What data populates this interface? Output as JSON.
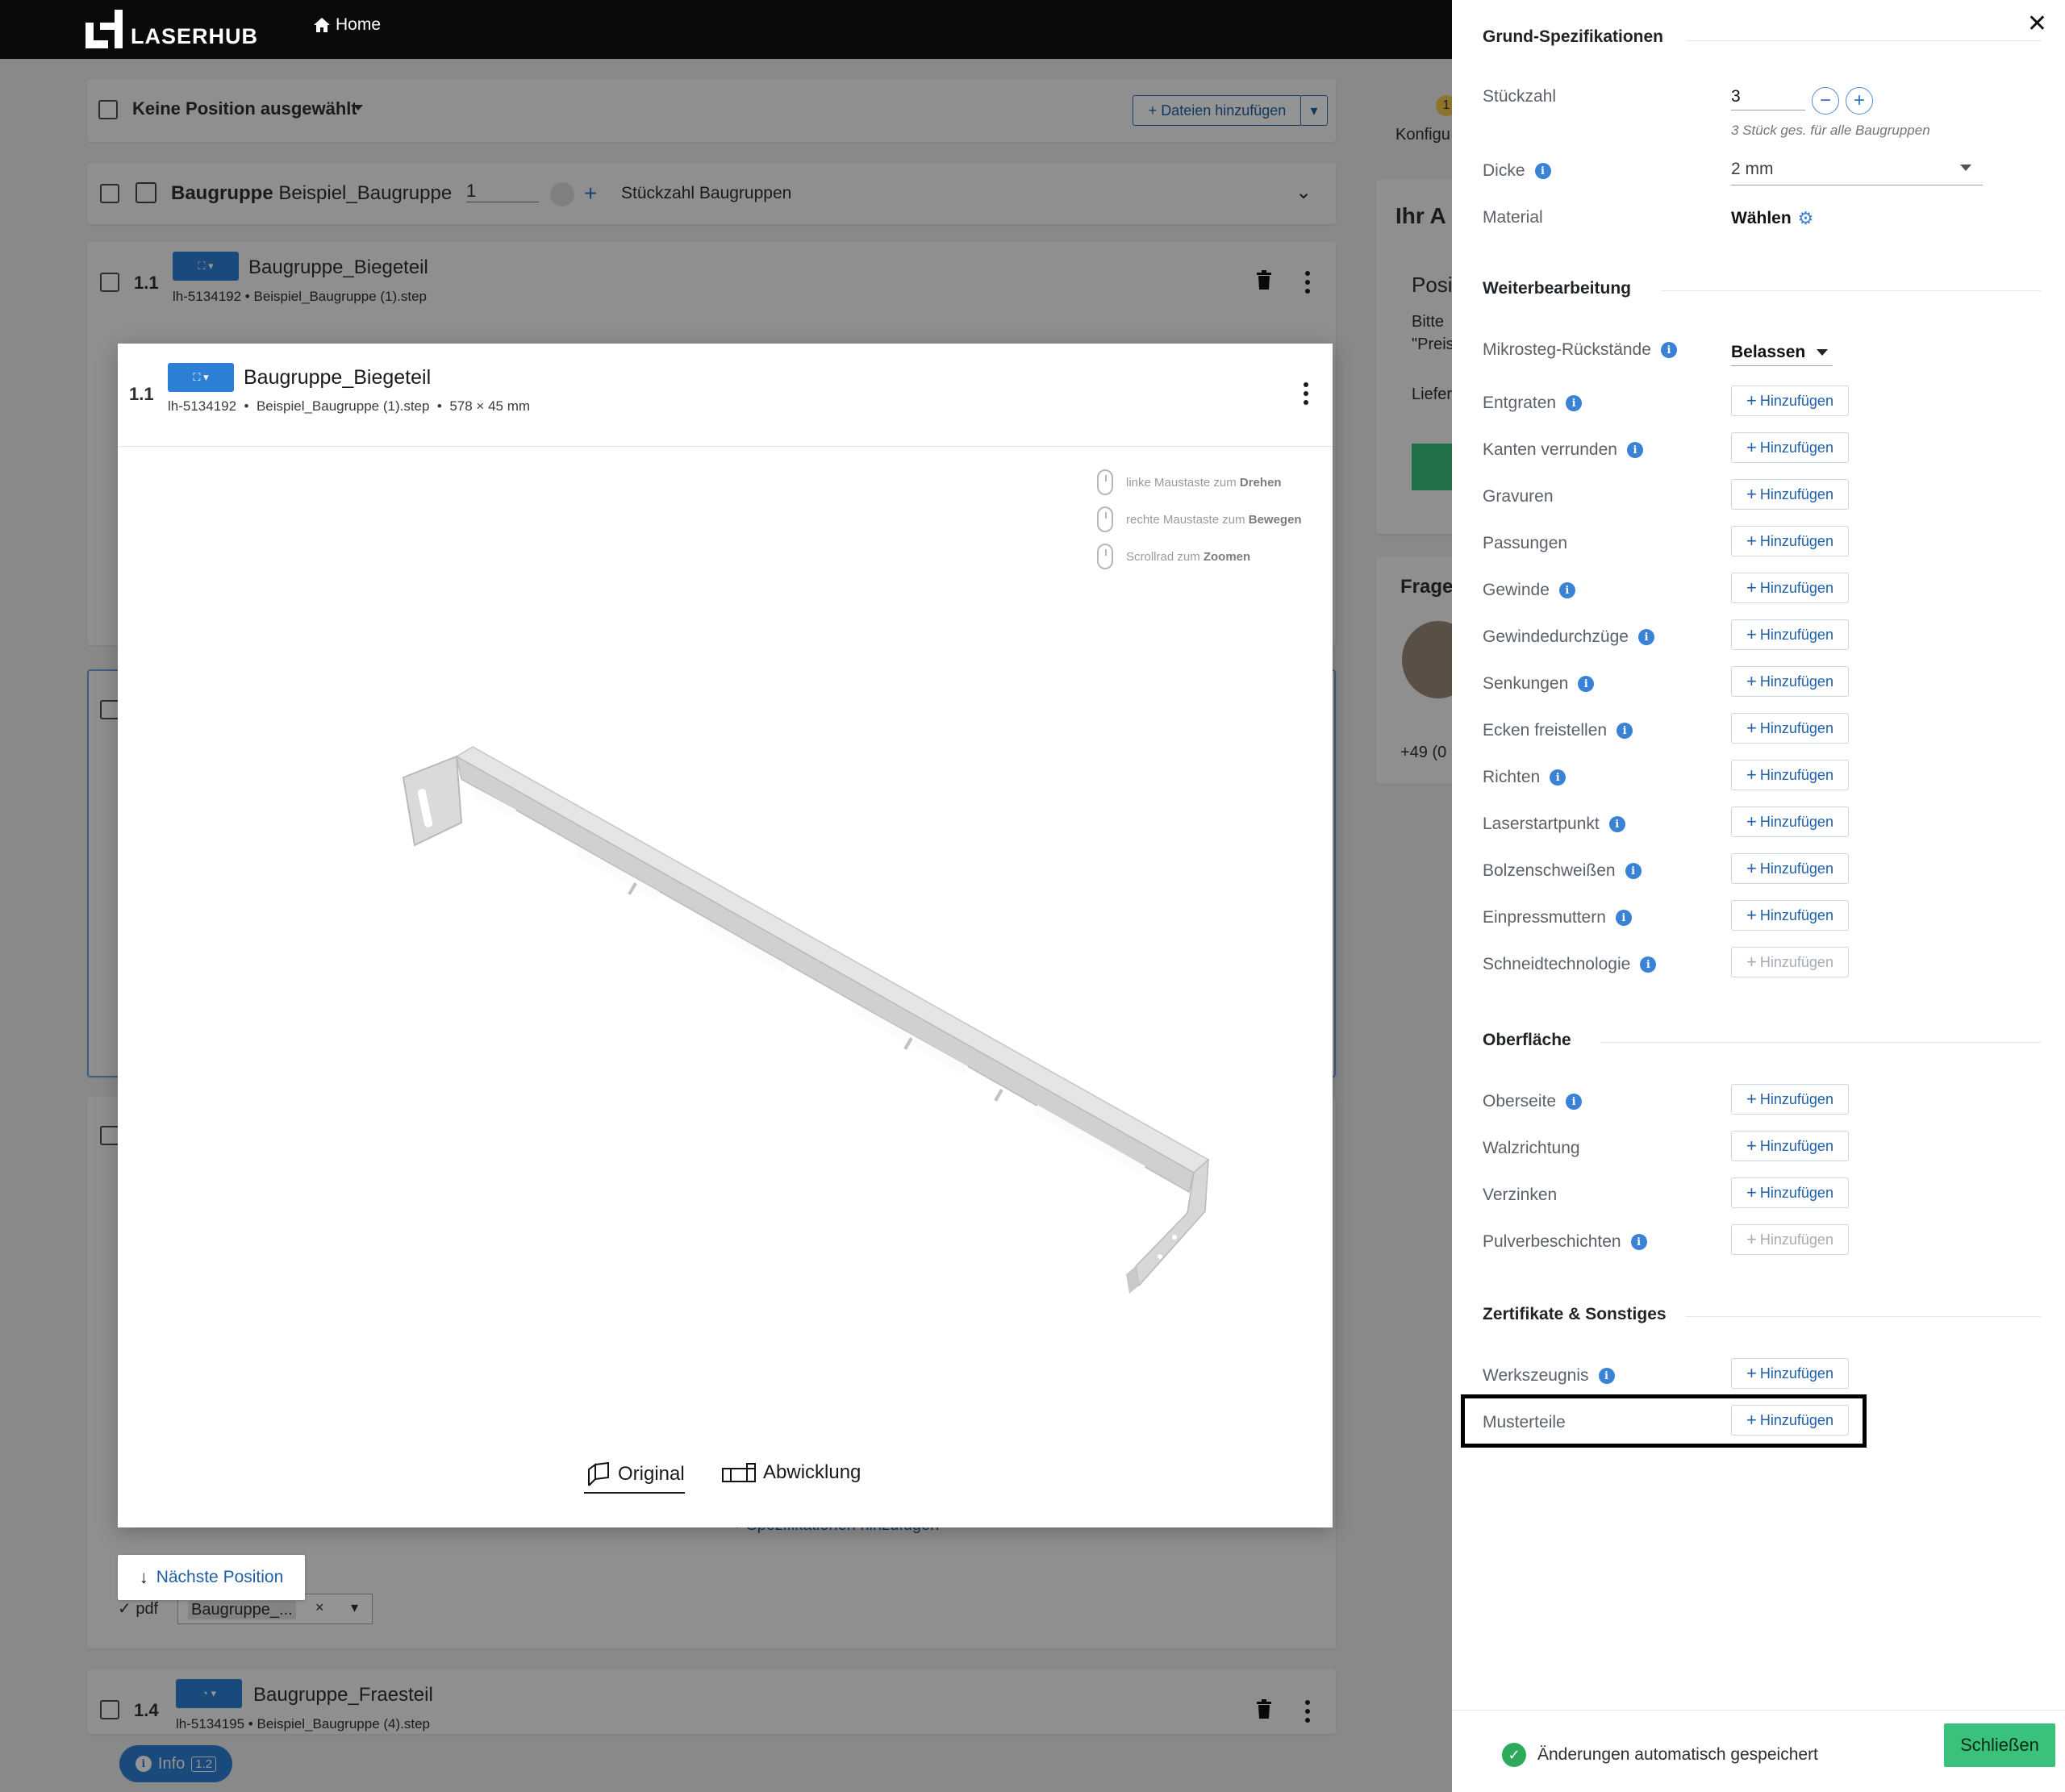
{
  "nav": {
    "brand": "LASERHUB",
    "home": "Home"
  },
  "toolbar": {
    "select_label": "Keine Position ausgewählt",
    "add_files": "Dateien hinzufügen"
  },
  "group": {
    "prefix": "Baugruppe",
    "name": "Beispiel_Baugruppe",
    "qty": "1",
    "qty_label": "Stückzahl Baugruppen"
  },
  "items": [
    {
      "pos": "1.1",
      "name": "Baugruppe_Biegeteil",
      "id": "lh-5134192",
      "file": "Beispiel_Baugruppe (1).step"
    },
    {
      "pos": "1.4",
      "name": "Baugruppe_Fraesteil",
      "id": "lh-5134195",
      "file": "Beispiel_Baugruppe (4).step"
    }
  ],
  "bg_partial": {
    "konfig": "Konfigu",
    "ihr": "Ihr A",
    "pos": "Posi",
    "bitte": "Bitte",
    "preis": "\"Preis",
    "liefer": "Liefer",
    "frage": "Frage",
    "phone": "+49 (0",
    "spec_link": "+ Spezifikationen hinzufügen",
    "pdf_label": "✓ pdf",
    "pdf_chip": "Baugruppe_...",
    "info": "Info",
    "info_ver": "1.2",
    "badge": "1"
  },
  "viewer": {
    "pos": "1.1",
    "title": "Baugruppe_Biegeteil",
    "id": "lh-5134192",
    "file": "Beispiel_Baugruppe (1).step",
    "dims": "578 × 45 mm",
    "hints": [
      {
        "pre": "linke Maustaste zum ",
        "bold": "Drehen"
      },
      {
        "pre": "rechte Maustaste zum ",
        "bold": "Bewegen"
      },
      {
        "pre": "Scrollrad zum ",
        "bold": "Zoomen"
      }
    ],
    "tab_original": "Original",
    "tab_abwicklung": "Abwicklung"
  },
  "next_position": "Nächste Position",
  "panel": {
    "sections": {
      "grund": "Grund-Spezifikationen",
      "weiter": "Weiterbearbeitung",
      "oberflaeche": "Oberfläche",
      "zertifikate": "Zertifikate & Sonstiges"
    },
    "qty_label": "Stückzahl",
    "qty_value": "3",
    "qty_hint": "3 Stück ges. für alle Baugruppen",
    "thickness_label": "Dicke",
    "thickness_value": "2 mm",
    "material_label": "Material",
    "material_value": "Wählen",
    "micro_label": "Mikrosteg-Rückstände",
    "micro_value": "Belassen",
    "add_label": "Hinzufügen",
    "weiter_rows": [
      "Entgraten",
      "Kanten verrunden",
      "Gravuren",
      "Passungen",
      "Gewinde",
      "Gewindedurchzüge",
      "Senkungen",
      "Ecken freistellen",
      "Richten",
      "Laserstartpunkt",
      "Bolzenschweißen",
      "Einpressmuttern",
      "Schneidtechnologie"
    ],
    "oberflaeche_rows": [
      "Oberseite",
      "Walzrichtung",
      "Verzinken",
      "Pulverbeschichten"
    ],
    "zert_rows": [
      "Werkszeugnis",
      "Musterteile"
    ],
    "saved": "Änderungen automatisch gespeichert",
    "close": "Schließen"
  },
  "colors": {
    "accent": "#2d7fd6",
    "success": "#3ac27c",
    "link": "#1f5fa8"
  }
}
